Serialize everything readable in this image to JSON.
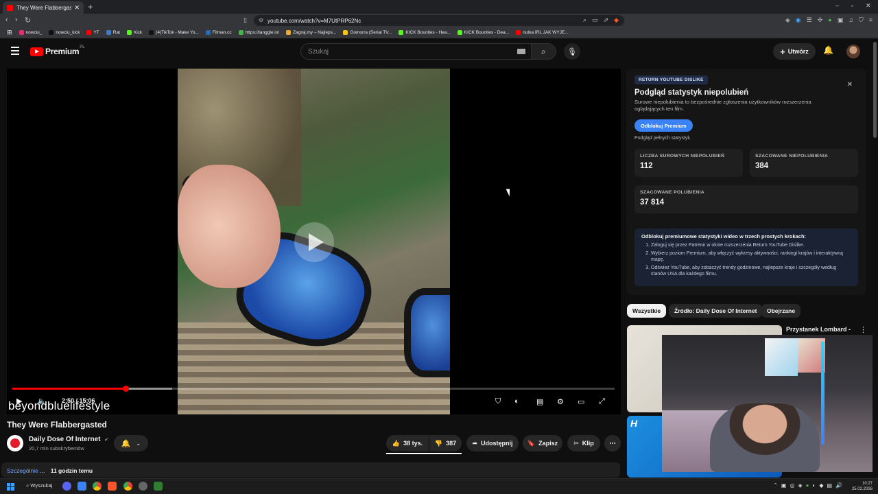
{
  "browser": {
    "tab_title": "They Were Flabbergasted - YouT",
    "url": "youtube.com/watch?v=M7UtPRP62Nc",
    "bookmarks": [
      {
        "label": "nowciu_",
        "color": "#e1306c"
      },
      {
        "label": "nowciu_kick",
        "color": "#111111"
      },
      {
        "label": "YT",
        "color": "#ff0000"
      },
      {
        "label": "Rat",
        "color": "#3a7bd5"
      },
      {
        "label": "Kick",
        "color": "#53fc18"
      },
      {
        "label": "(4)TikTok - Make Yo...",
        "color": "#111111"
      },
      {
        "label": "Filman.cc",
        "color": "#2b6cb0"
      },
      {
        "label": "https://tanggle.io/",
        "color": "#4caf50"
      },
      {
        "label": "Zagraj.my – Najleps...",
        "color": "#f5a623"
      },
      {
        "label": "Gomorra (Serial TV...",
        "color": "#f5c518"
      },
      {
        "label": "KICK Bounties - Hea...",
        "color": "#53fc18"
      },
      {
        "label": "KICK Bounties - Dea...",
        "color": "#53fc18"
      },
      {
        "label": "nutka IRL JAK WYJE...",
        "color": "#ff0000"
      }
    ]
  },
  "yt": {
    "logo": "Premium",
    "logo_region": "PL",
    "search_placeholder": "Szukaj",
    "create_label": "Utwórz"
  },
  "player": {
    "time": "2:50 / 15:06",
    "progress": 0.188,
    "buffered": 0.265,
    "watermark": "beyondbluelifestyle"
  },
  "video": {
    "title": "They Were Flabbergasted",
    "channel": "Daily Dose Of Internet",
    "verified": "✔",
    "subscribers": "20,7 mln subskrybentów",
    "likes": "38 tys.",
    "dislikes": "387",
    "share": "Udostępnij",
    "save": "Zapisz",
    "clip": "Klip",
    "desc_views": "Szczególnie",
    "desc_overlay": "...",
    "desc_time": "11 godzin temu"
  },
  "ryd": {
    "tag": "RETURN YOUTUBE DISLIKE",
    "title": "Podgląd statystyk niepolubień",
    "description": "Surowe niepolubienia to bezpośrednie zgłoszenia użytkowników rozszerzenia oglądających ten film.",
    "unlock_button": "Odblokuj Premium",
    "full_stats": "Podgląd pełnych statystyk",
    "raw_dislikes_label": "LICZBA SUROWYCH NIEPOLUBIEŃ",
    "raw_dislikes": "112",
    "est_dislikes_label": "SZACOWANE NIEPOLUBIENIA",
    "est_dislikes": "384",
    "est_likes_label": "SZACOWANE POLUBIENIA",
    "est_likes": "37 814",
    "promo_title": "Odblokuj premiumowe statystyki wideo w trzech prostych krokach:",
    "steps": [
      "Zaloguj się przez Patreon w oknie rozszerzenia Return YouTube Dislike.",
      "Wybierz poziom Premium, aby włączyć wykresy aktywności, rankingi krajów i interaktywną mapę.",
      "Odśwież YouTube, aby zobaczyć trendy godzinowe, najlepsze kraje i szczegóły według stanów USA dla każdego filmu."
    ]
  },
  "chips": [
    "Wszystkie",
    "Źródło: Daily Dose Of Internet",
    "Obejrzane"
  ],
  "related": [
    {
      "title": "Przystanek Lombard -"
    }
  ],
  "taskbar": {
    "search": "Wyszukaj",
    "time": "10:27",
    "date": "25.02.2026"
  }
}
